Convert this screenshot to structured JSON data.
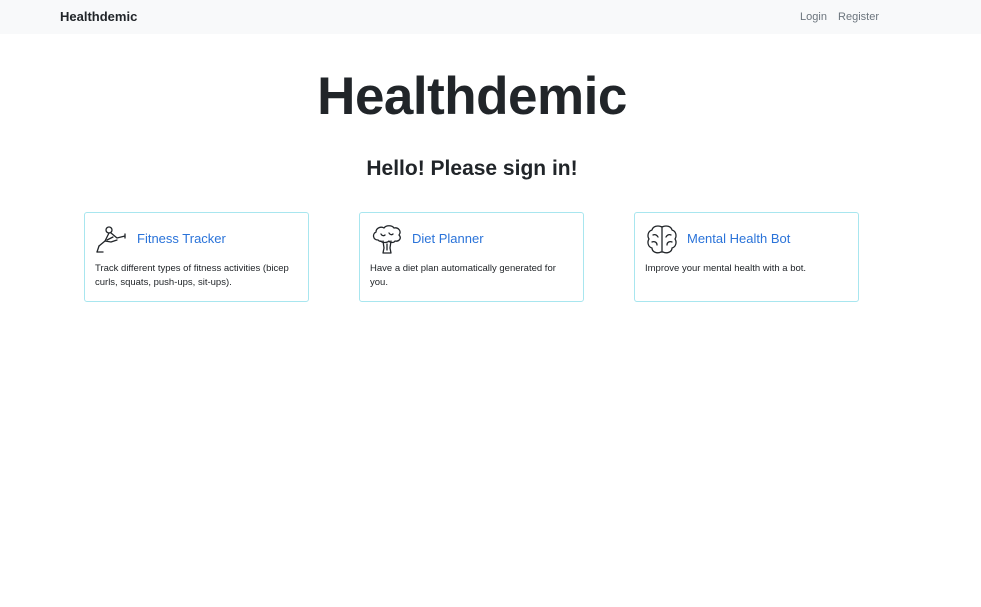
{
  "navbar": {
    "brand": "Healthdemic",
    "links": [
      {
        "label": "Login"
      },
      {
        "label": "Register"
      }
    ]
  },
  "hero": {
    "title": "Healthdemic",
    "subtitle": "Hello! Please sign in!"
  },
  "cards": [
    {
      "icon": "fitness-icon",
      "title": "Fitness Tracker",
      "text": "Track different types of fitness activities (bicep curls, squats, push-ups, sit-ups)."
    },
    {
      "icon": "broccoli-icon",
      "title": "Diet Planner",
      "text": "Have a diet plan automatically generated for you."
    },
    {
      "icon": "brain-icon",
      "title": "Mental Health Bot",
      "text": "Improve your mental health with a bot."
    }
  ],
  "colors": {
    "navbar_bg": "#f8f9fa",
    "link": "#2a73d9",
    "card_border": "#a8e6ef"
  }
}
